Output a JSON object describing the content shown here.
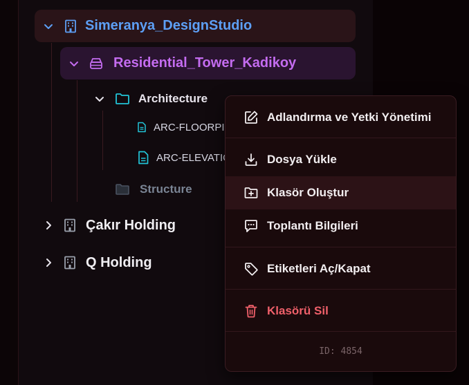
{
  "tree": {
    "studio": {
      "label": "Simeranya_DesignStudio",
      "icon": "building-icon",
      "expanded": true
    },
    "project": {
      "label": "Residential_Tower_Kadikoy",
      "icon": "stack-icon",
      "expanded": true
    },
    "architecture_folder": {
      "label": "Architecture",
      "icon": "folder-icon",
      "expanded": true
    },
    "files": [
      {
        "label": "ARC-FLOORPI",
        "icon": "file-icon"
      },
      {
        "label": "ARC-ELEVATIO",
        "icon": "file-icon"
      }
    ],
    "structure_folder": {
      "label": "Structure",
      "icon": "folder-icon"
    },
    "holdings": [
      {
        "label": "Çakır Holding",
        "icon": "building-icon",
        "expanded": false
      },
      {
        "label": "Q Holding",
        "icon": "building-icon",
        "expanded": false
      }
    ]
  },
  "context_menu": {
    "items": [
      {
        "label": "Adlandırma ve Yetki Yönetimi",
        "icon": "edit-icon"
      },
      {
        "label": "Dosya Yükle",
        "icon": "download-icon"
      },
      {
        "label": "Klasör Oluştur",
        "icon": "folder-plus-icon"
      },
      {
        "label": "Toplantı Bilgileri",
        "icon": "message-icon"
      },
      {
        "label": "Etiketleri Aç/Kapat",
        "icon": "tag-icon"
      },
      {
        "label": "Klasörü Sil",
        "icon": "trash-icon"
      }
    ],
    "id_label": "ID: 4854"
  },
  "colors": {
    "studio": "#5d9ff5",
    "project": "#c46cf0",
    "file": "#22c5d8",
    "danger": "#f0606a"
  }
}
